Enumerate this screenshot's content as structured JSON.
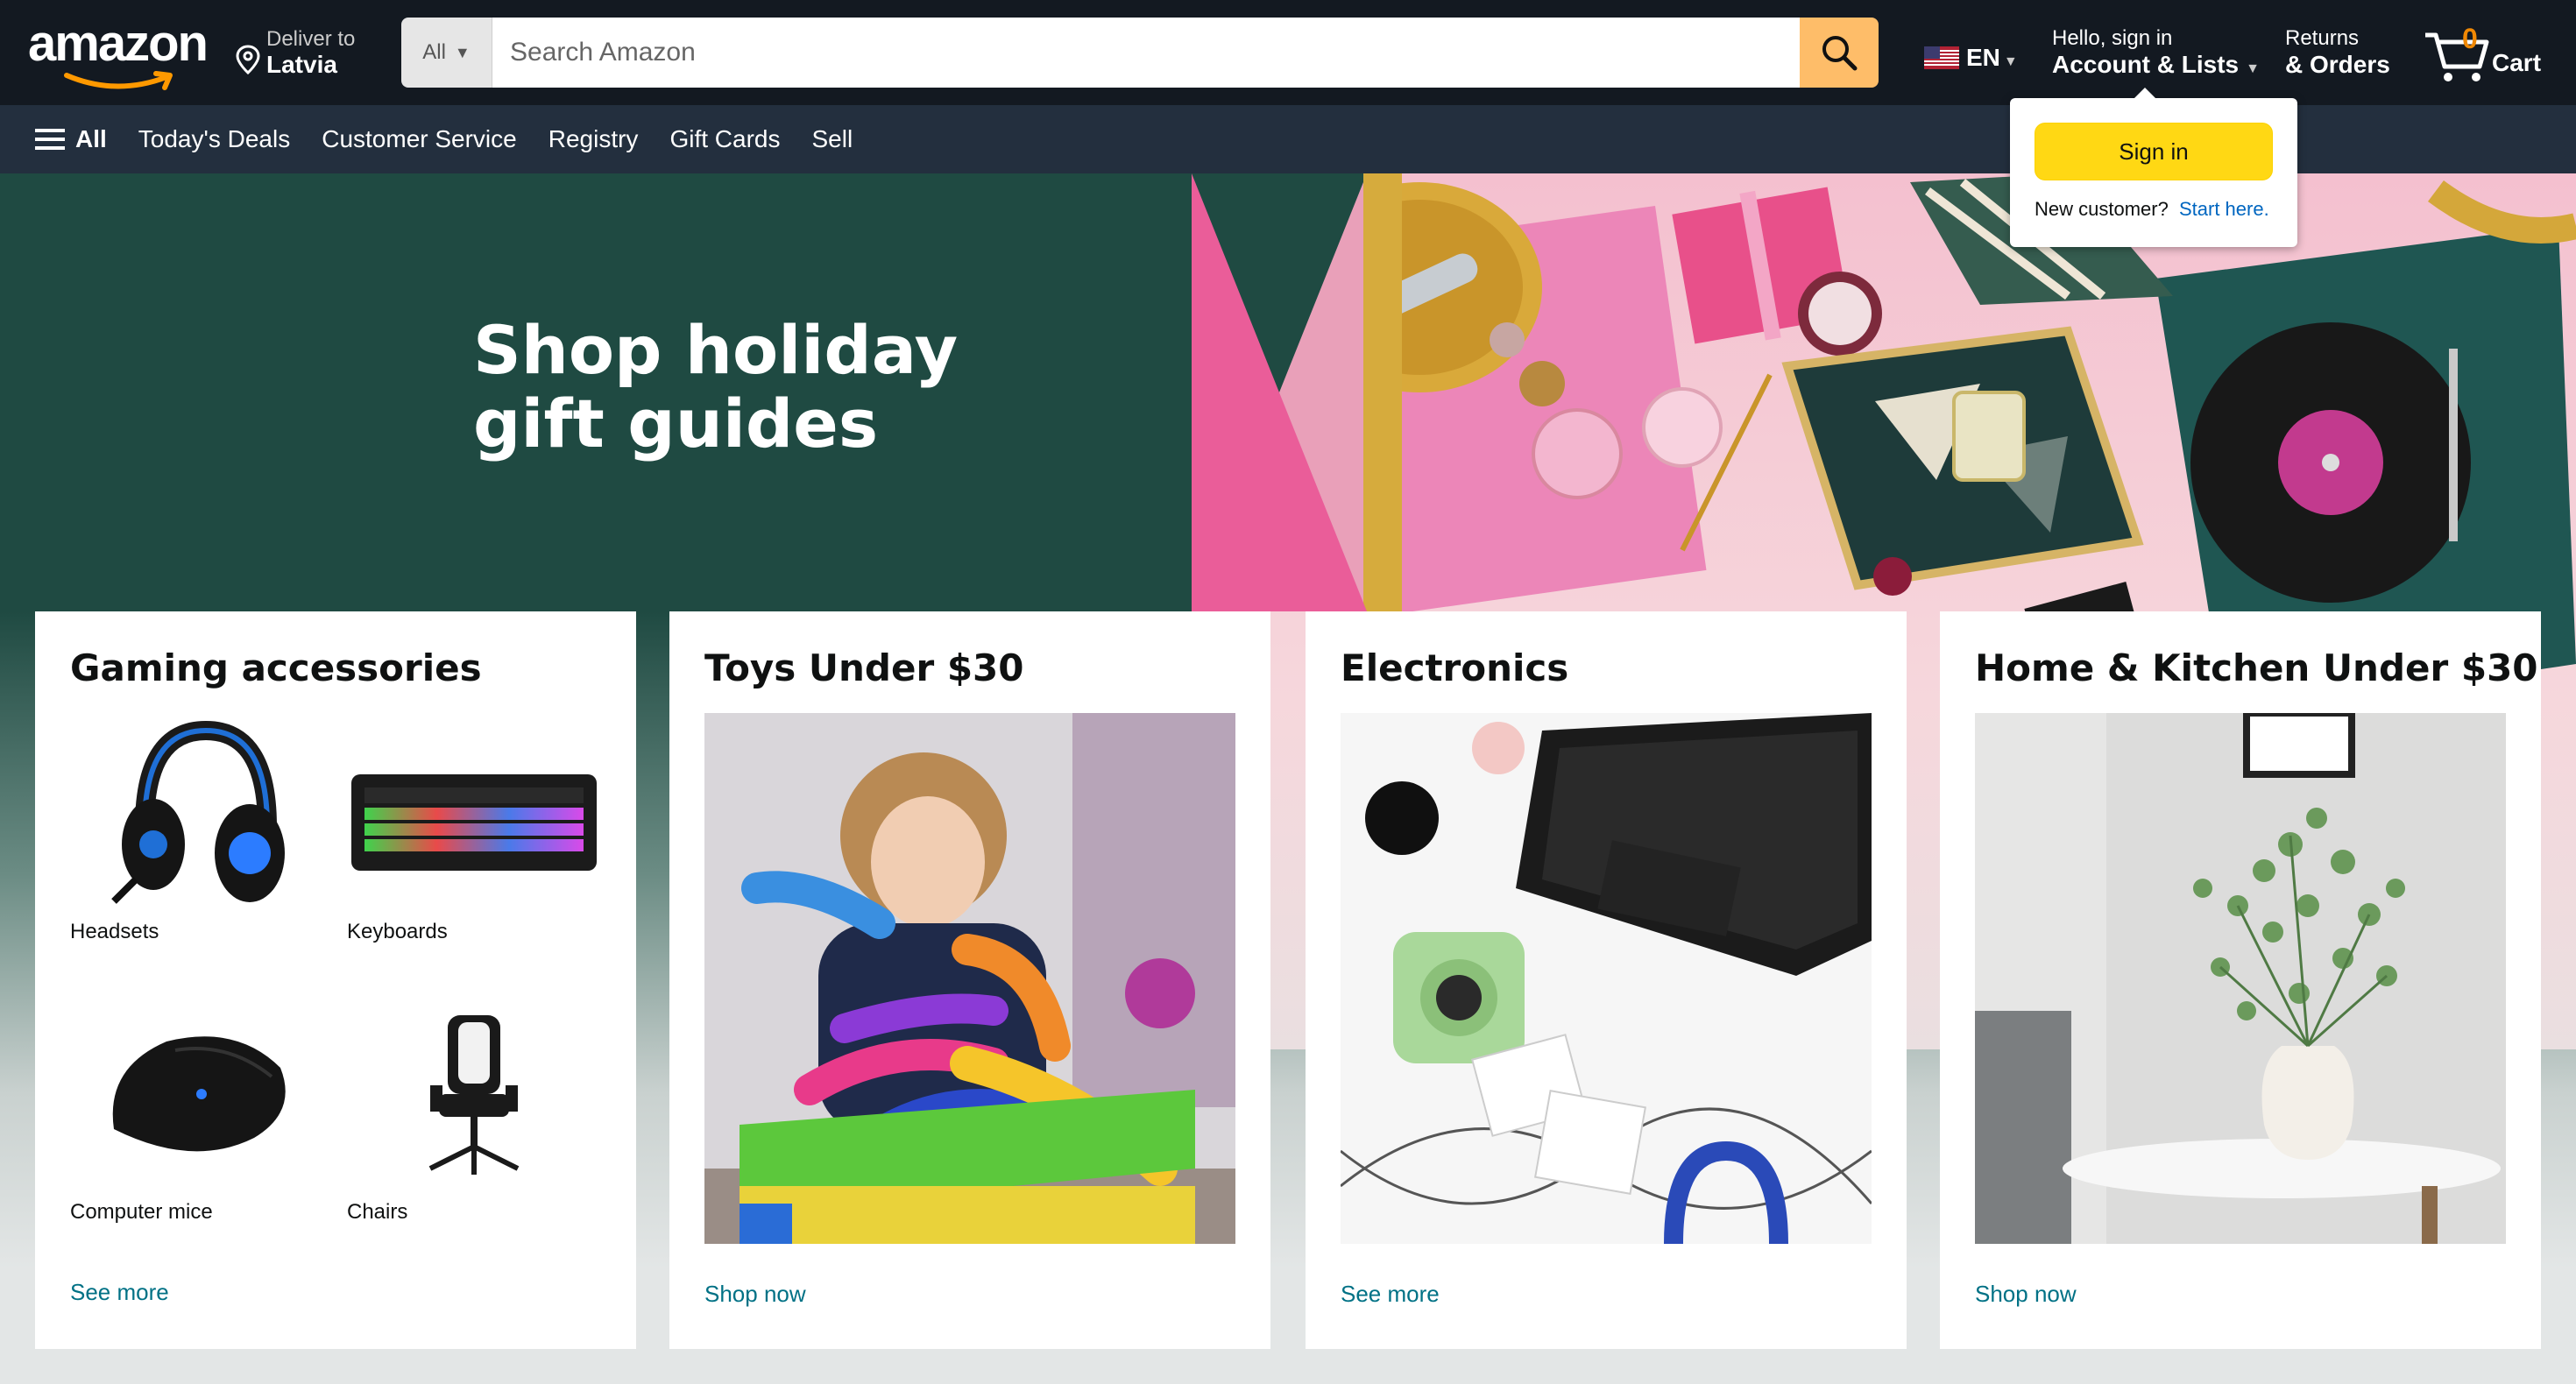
{
  "header": {
    "logo_text": "amazon",
    "deliver_line1": "Deliver to",
    "deliver_line2": "Latvia",
    "search_category": "All",
    "search_placeholder": "Search Amazon",
    "language": "EN",
    "account_line1": "Hello, sign in",
    "account_line2": "Account & Lists",
    "returns_line1": "Returns",
    "returns_line2": "& Orders",
    "cart_count": "0",
    "cart_label": "Cart"
  },
  "subnav": {
    "all_label": "All",
    "items": [
      "Today's Deals",
      "Customer Service",
      "Registry",
      "Gift Cards",
      "Sell"
    ]
  },
  "hero": {
    "title_line1": "Shop holiday",
    "title_line2": "gift guides"
  },
  "signin_popover": {
    "button_label": "Sign in",
    "new_customer_text": "New customer?",
    "start_link": "Start here."
  },
  "cards": [
    {
      "title": "Gaming accessories",
      "items": [
        "Headsets",
        "Keyboards",
        "Computer mice",
        "Chairs"
      ],
      "link": "See more"
    },
    {
      "title": "Toys Under $30",
      "link": "Shop now"
    },
    {
      "title": "Electronics",
      "link": "See more"
    },
    {
      "title": "Home & Kitchen Under $30",
      "link": "Shop now"
    }
  ],
  "colors": {
    "nav_top": "#131921",
    "nav_sub": "#232f3e",
    "search_button": "#febd69",
    "signin_button": "#ffd814",
    "link": "#007185",
    "cart_count": "#f08804",
    "hero_green": "#1f4a42"
  }
}
